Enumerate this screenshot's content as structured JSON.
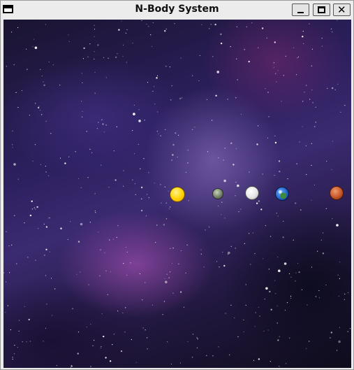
{
  "window": {
    "title": "N-Body System",
    "buttons": {
      "minimize": "_",
      "maximize": "□",
      "close": "✕"
    }
  },
  "simulation": {
    "background": "starfield-nebula",
    "bodies": [
      {
        "name": "sun",
        "color": "#ffd000"
      },
      {
        "name": "mercury",
        "color": "#6f7a64"
      },
      {
        "name": "venus",
        "color": "#e6e6e6"
      },
      {
        "name": "earth",
        "color": "#1d5fc9"
      },
      {
        "name": "mars",
        "color": "#c4572b"
      }
    ]
  }
}
